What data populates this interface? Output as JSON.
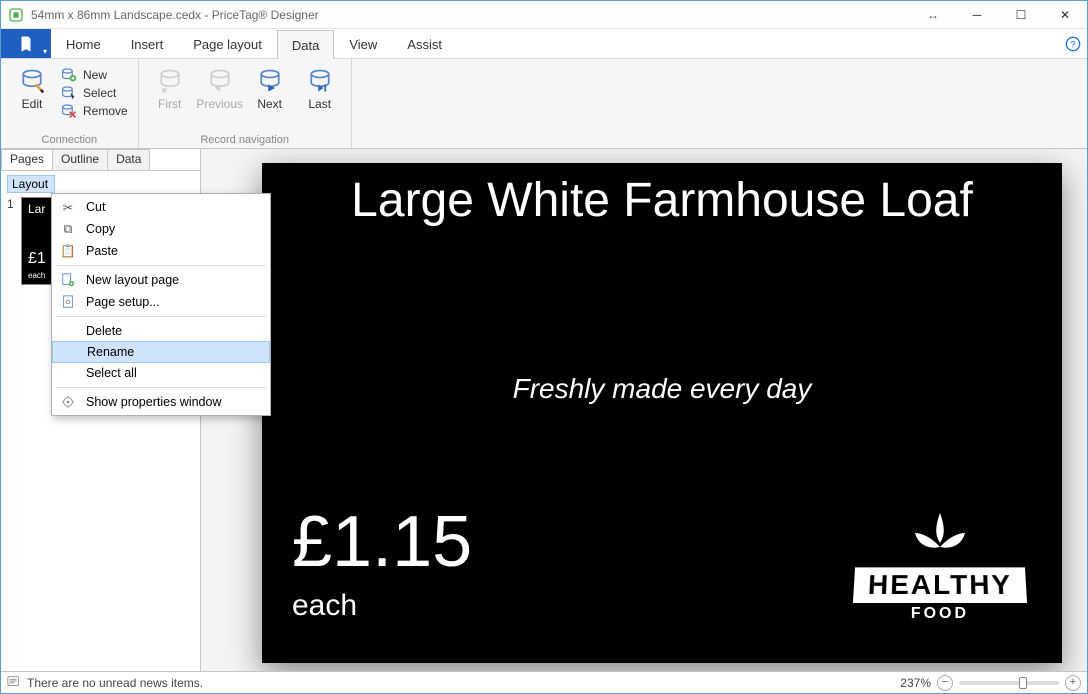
{
  "title": "54mm x 86mm Landscape.cedx - PriceTag® Designer",
  "menu": {
    "items": [
      "Home",
      "Insert",
      "Page layout",
      "Data",
      "View",
      "Assist"
    ],
    "active": "Data"
  },
  "ribbon": {
    "connection": {
      "label": "Connection",
      "edit": "Edit",
      "new": "New",
      "select": "Select",
      "remove": "Remove"
    },
    "navigation": {
      "label": "Record navigation",
      "first": "First",
      "previous": "Previous",
      "next": "Next",
      "last": "Last"
    }
  },
  "side": {
    "tabs": [
      "Pages",
      "Outline",
      "Data"
    ],
    "active": "Pages",
    "layout_head": "Layout",
    "page_number": "1",
    "thumb": {
      "title": "Lar",
      "price": "£1",
      "each": "each"
    }
  },
  "context": {
    "cut": "Cut",
    "copy": "Copy",
    "paste": "Paste",
    "new_layout_page": "New layout page",
    "page_setup": "Page setup...",
    "delete": "Delete",
    "rename": "Rename",
    "select_all": "Select all",
    "show_properties": "Show properties window",
    "hovered": "rename"
  },
  "canvas": {
    "title": "Large White Farmhouse Loaf",
    "subtitle": "Freshly made every day",
    "price": "£1.15",
    "each": "each",
    "logo": {
      "band": "HEALTHY",
      "sub": "FOOD"
    }
  },
  "status": {
    "news": "There are no unread news items.",
    "zoom": "237%"
  }
}
